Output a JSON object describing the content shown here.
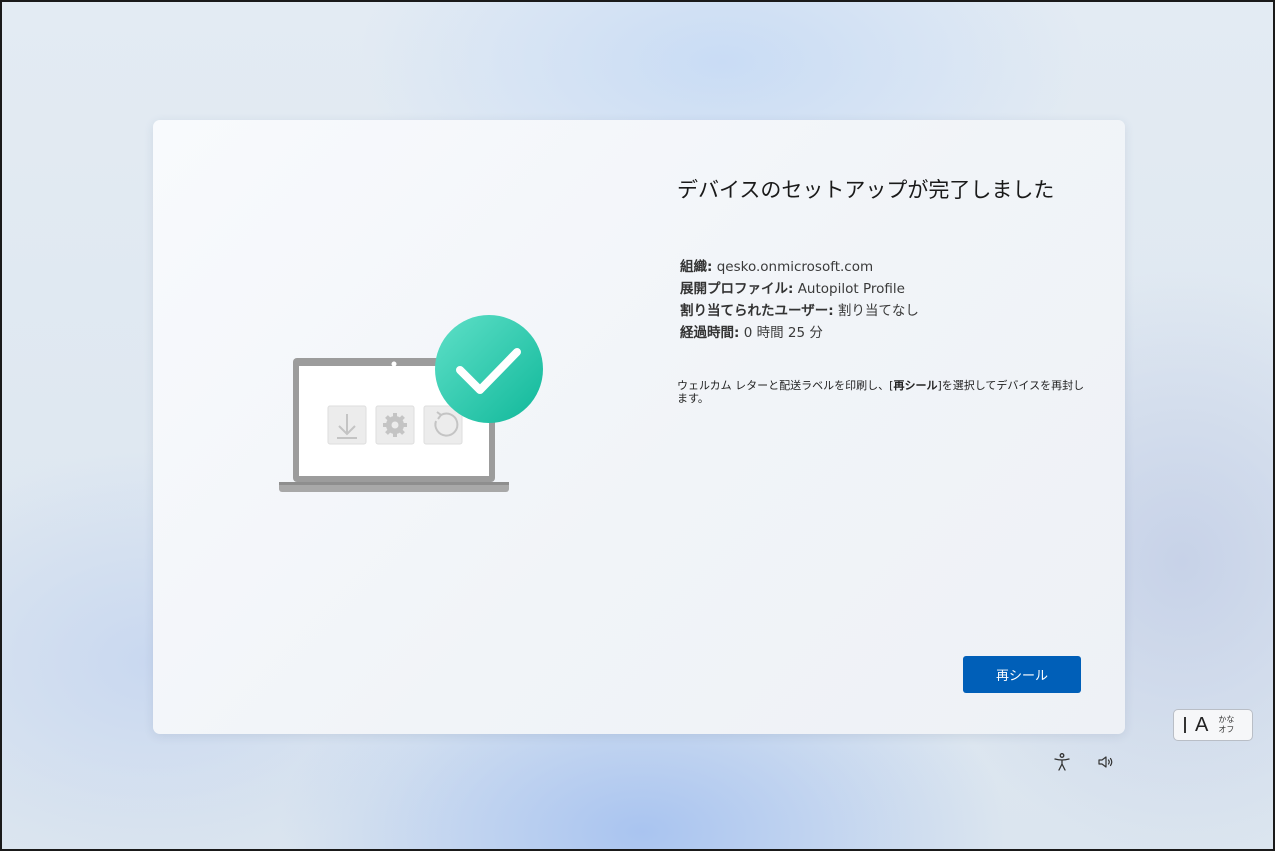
{
  "dialog": {
    "title": "デバイスのセットアップが完了しました",
    "info": [
      {
        "label": "組織:",
        "value": " qesko.onmicrosoft.com"
      },
      {
        "label": "展開プロファイル:",
        "value": " Autopilot Profile"
      },
      {
        "label": "割り当てられたユーザー:",
        "value": " 割り当てなし"
      },
      {
        "label": "経過時間:",
        "value": " 0 時間 25 分"
      }
    ],
    "description": {
      "before": "ウェルカム レターと配送ラベルを印刷し、[",
      "bold": "再シール",
      "after": "]を選択してデバイスを再封します。"
    },
    "reseal_button": "再シール"
  },
  "illustration": {
    "icons": [
      "download-icon",
      "settings-gear-icon",
      "refresh-icon"
    ],
    "badge": "checkmark-icon",
    "accent_color": "#20c4a5"
  },
  "system_tray": {
    "ime": {
      "mode_letter": "A",
      "kana_top": "かな",
      "kana_bottom": "オフ"
    },
    "icons": [
      "accessibility-icon",
      "volume-icon"
    ]
  },
  "colors": {
    "button": "#005fb8",
    "card": "#f6f8fb"
  }
}
